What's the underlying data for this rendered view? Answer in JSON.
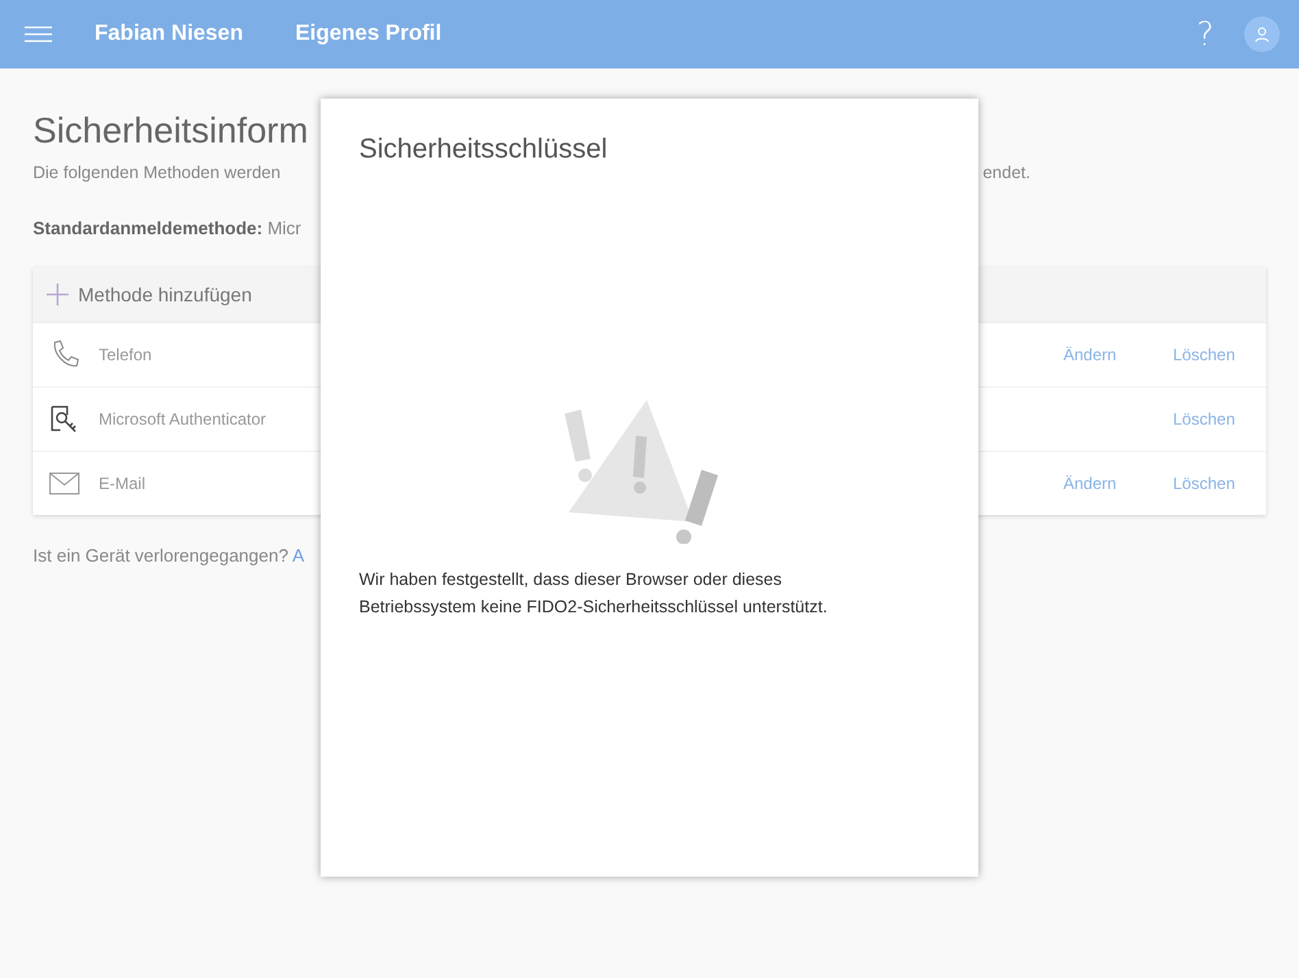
{
  "header": {
    "user_name": "Fabian Niesen",
    "page_title": "Eigenes Profil",
    "help": "?"
  },
  "page": {
    "title": "Sicherheitsinform",
    "intro_left": "Die folgenden Methoden werden",
    "intro_right": "endet.",
    "default_method": "**Standardanmeldemethode:** Micr",
    "add_method": "Methode hinzufügen",
    "methods": [
      {
        "kind": "phone",
        "name": "Telefon",
        "change": "Ändern",
        "delete": "Löschen"
      },
      {
        "kind": "authenticator",
        "name": "Microsoft Authenticator",
        "delete": "Löschen"
      },
      {
        "kind": "email",
        "name": "E-Mail",
        "change": "Ändern",
        "delete": "Löschen"
      }
    ],
    "lost_device": "Ist ein Gerät verlorengegangen?",
    "lost_device_link": "A"
  },
  "dialog": {
    "title": "Sicherheitsschlüssel",
    "message": "Wir haben festgestellt, dass dieser Browser oder dieses Betriebssystem keine FIDO2-Sicherheitsschlüssel unterstützt."
  }
}
